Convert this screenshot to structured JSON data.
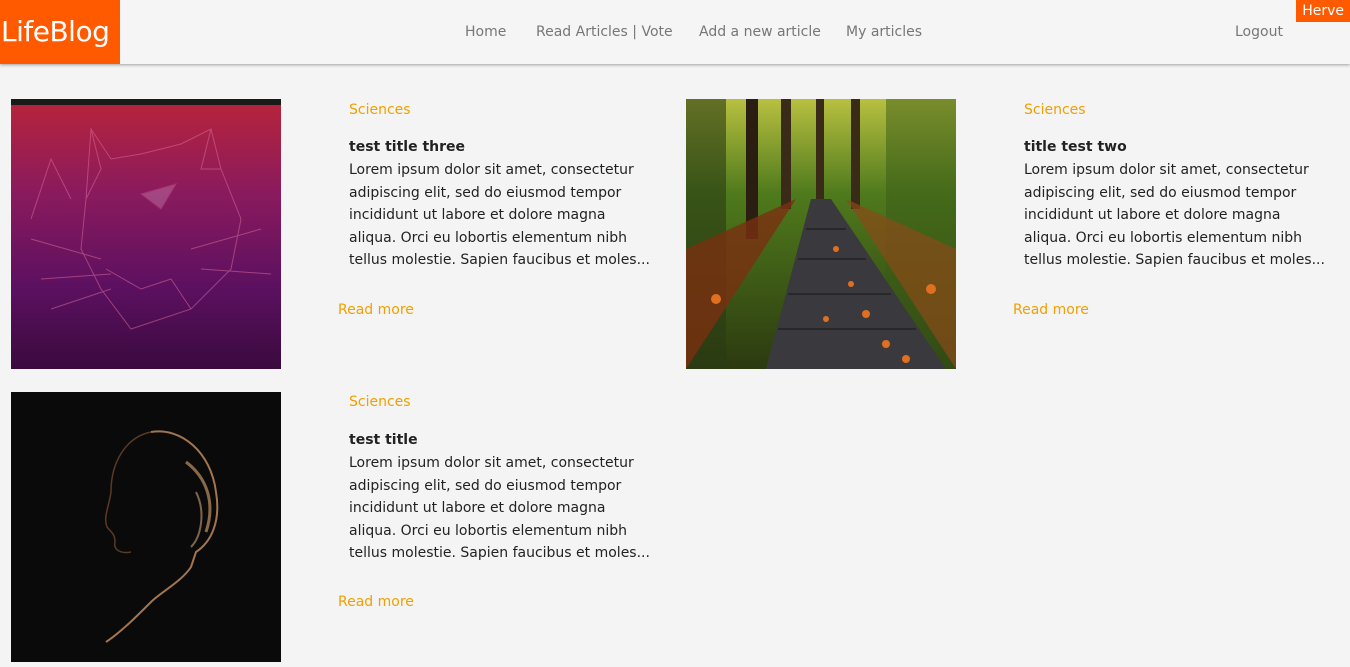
{
  "nav": {
    "logo": "LifeBlog",
    "links": [
      "Home",
      "Read Articles | Vote",
      "Add a new article",
      "My articles"
    ],
    "logout": "Logout",
    "user": "Herve"
  },
  "articles": [
    {
      "category": "Sciences",
      "title": "test title three",
      "excerpt": "Lorem ipsum dolor sit amet, consectetur adipiscing elit, sed do eiusmod tempor incididunt ut labore et dolore magna aliqua. Orci eu lobortis elementum nibh tellus molestie. Sapien faucibus et moles...",
      "read_more": "Read more",
      "image": "ubuntu-wallpaper"
    },
    {
      "category": "Sciences",
      "title": "title test two",
      "excerpt": "Lorem ipsum dolor sit amet, consectetur adipiscing elit, sed do eiusmod tempor incididunt ut labore et dolore magna aliqua. Orci eu lobortis elementum nibh tellus molestie. Sapien faucibus et moles...",
      "read_more": "Read more",
      "image": "forest-boardwalk"
    },
    {
      "category": "Sciences",
      "title": "test title",
      "excerpt": "Lorem ipsum dolor sit amet, consectetur adipiscing elit, sed do eiusmod tempor incididunt ut labore et dolore magna aliqua. Orci eu lobortis elementum nibh tellus molestie. Sapien faucibus et moles...",
      "read_more": "Read more",
      "image": "silhouette-portrait"
    }
  ],
  "colors": {
    "accent": "#ff5a00",
    "category": "#f0a000",
    "background": "#f4f4f4"
  }
}
